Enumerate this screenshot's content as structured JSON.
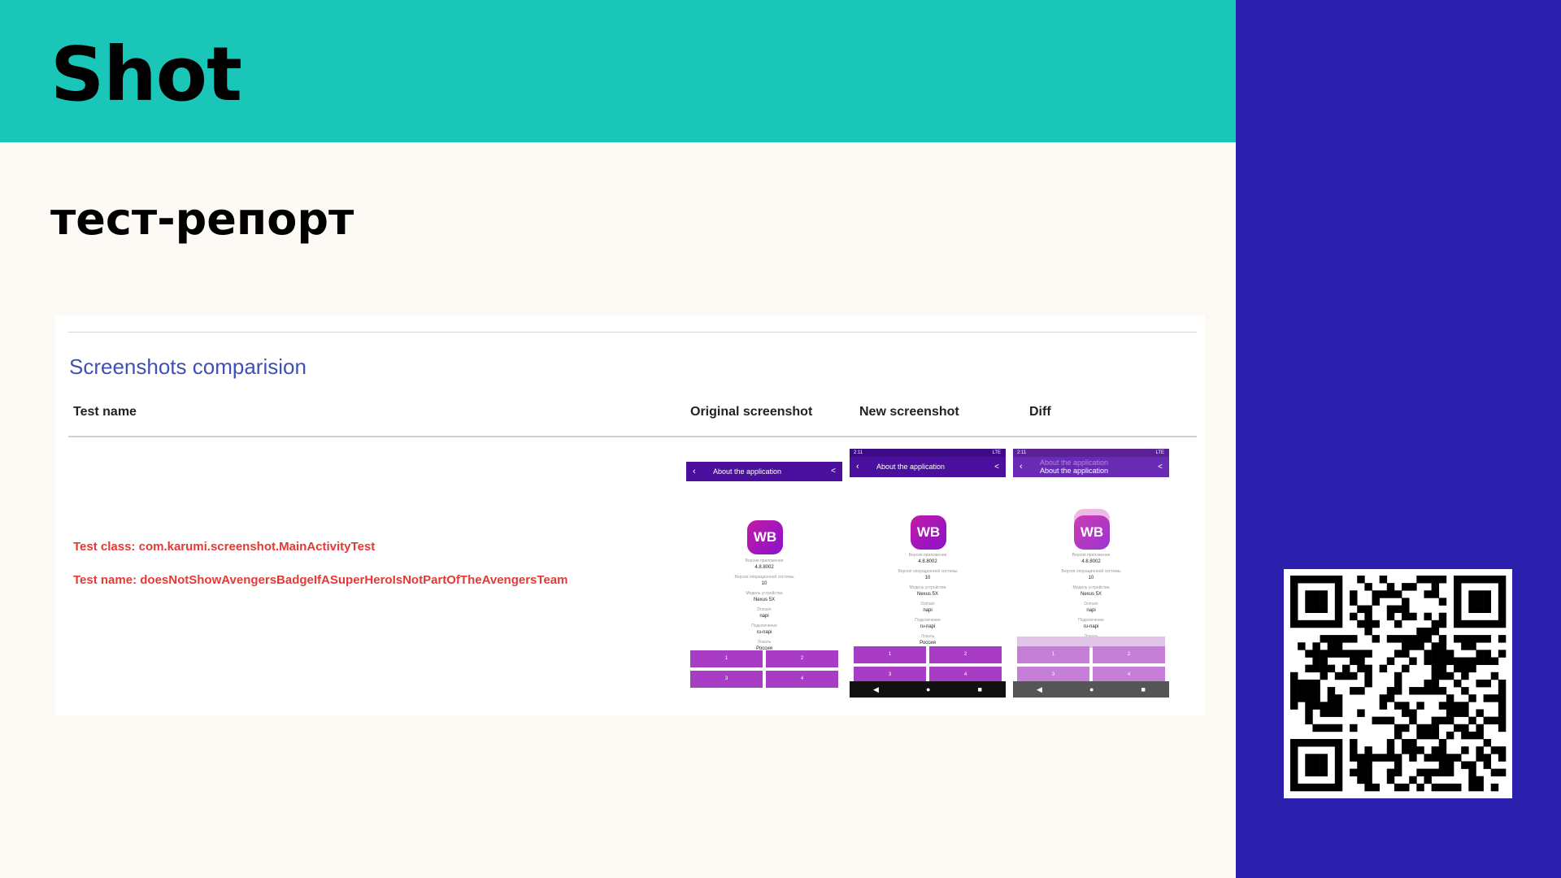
{
  "slide": {
    "title": "Shot",
    "subtitle": "тест-репорт",
    "colors": {
      "header": "#1ac6b8",
      "side_panel": "#2b1fae",
      "background": "#fdf9f4"
    }
  },
  "report": {
    "heading": "Screenshots comparision",
    "columns": [
      "Test name",
      "Original screenshot",
      "New screenshot",
      "Diff"
    ],
    "test_class": "Test class: com.karumi.screenshot.MainActivityTest",
    "test_name": "Test name: doesNotShowAvengersBadgeIfASuperHeroIsNotPartOfTheAvengersTeam"
  },
  "phone": {
    "status_time": "2:11",
    "status_right": "LTE",
    "appbar_title": "About the application",
    "logo": "WB",
    "info": [
      {
        "label": "Версия приложения",
        "value": "4.8.8002"
      },
      {
        "label": "Версия операционной системы",
        "value": "10"
      },
      {
        "label": "Модель устройства",
        "value": "Nexus 5X"
      },
      {
        "label": "Domain",
        "value": "napi"
      },
      {
        "label": "Подключение",
        "value": "ru-napi"
      },
      {
        "label": "Локаль",
        "value": "Россия"
      }
    ],
    "buttons": [
      "1",
      "2",
      "3",
      "4"
    ],
    "nav": [
      "◀",
      "●",
      "■"
    ],
    "icons": {
      "back": "arrow-left-icon",
      "share": "share-icon"
    }
  }
}
